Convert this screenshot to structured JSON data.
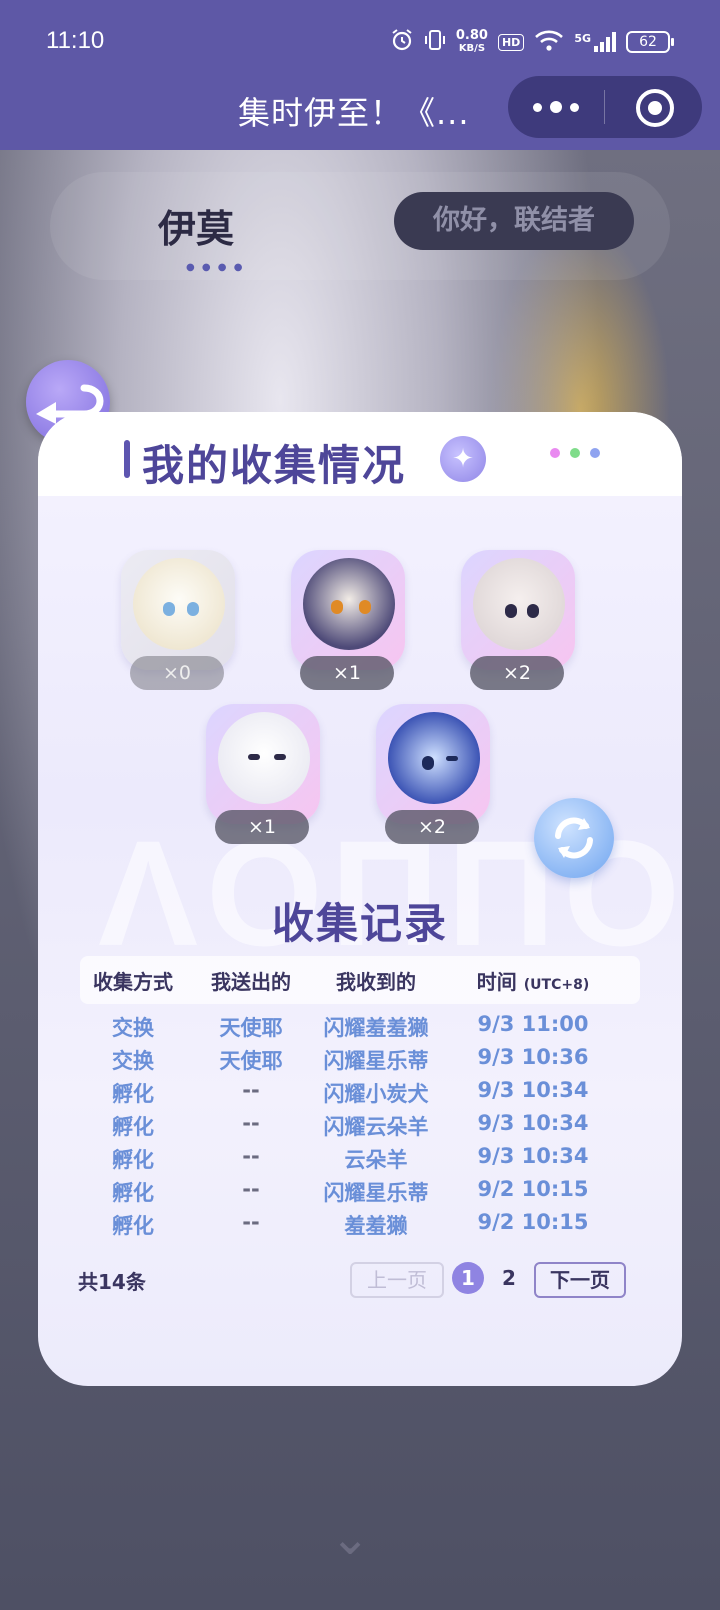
{
  "status_bar": {
    "time": "11:10",
    "net_speed_value": "0.80",
    "net_speed_unit": "KB/S",
    "hd": "HD",
    "network": "5G",
    "battery": "62"
  },
  "header": {
    "title": "集时伊至！《...",
    "menu_icon": "more-dots-icon",
    "close_icon": "target-close-icon"
  },
  "background_page": {
    "logo_text": "伊莫",
    "greeting": "你好，联结者"
  },
  "modal": {
    "title": "我的收集情况",
    "creatures": [
      {
        "count": "×0"
      },
      {
        "count": "×1"
      },
      {
        "count": "×2"
      },
      {
        "count": "×1"
      },
      {
        "count": "×2"
      }
    ],
    "records_title": "收集记录",
    "columns": {
      "method": "收集方式",
      "sent": "我送出的",
      "received": "我收到的",
      "time": "时间",
      "time_zone": "(UTC+8)"
    },
    "rows": [
      {
        "method": "交换",
        "sent": "天使耶",
        "received": "闪耀羞羞獭",
        "time": "9/3 11:00"
      },
      {
        "method": "交换",
        "sent": "天使耶",
        "received": "闪耀星乐蒂",
        "time": "9/3 10:36"
      },
      {
        "method": "孵化",
        "sent": "--",
        "received": "闪耀小炭犬",
        "time": "9/3 10:34"
      },
      {
        "method": "孵化",
        "sent": "--",
        "received": "闪耀云朵羊",
        "time": "9/3 10:34"
      },
      {
        "method": "孵化",
        "sent": "--",
        "received": "云朵羊",
        "time": "9/3 10:34"
      },
      {
        "method": "孵化",
        "sent": "--",
        "received": "闪耀星乐蒂",
        "time": "9/2 10:15"
      },
      {
        "method": "孵化",
        "sent": "--",
        "received": "羞羞獭",
        "time": "9/2 10:15"
      }
    ],
    "total": "共14条",
    "pager": {
      "prev": "上一页",
      "page1": "1",
      "page2": "2",
      "next": "下一页"
    }
  },
  "colors": {
    "header_bg": "#5e58a6",
    "accent": "#4e4699",
    "link_blue": "#6a8fd8",
    "active_page": "#8f84e2"
  }
}
